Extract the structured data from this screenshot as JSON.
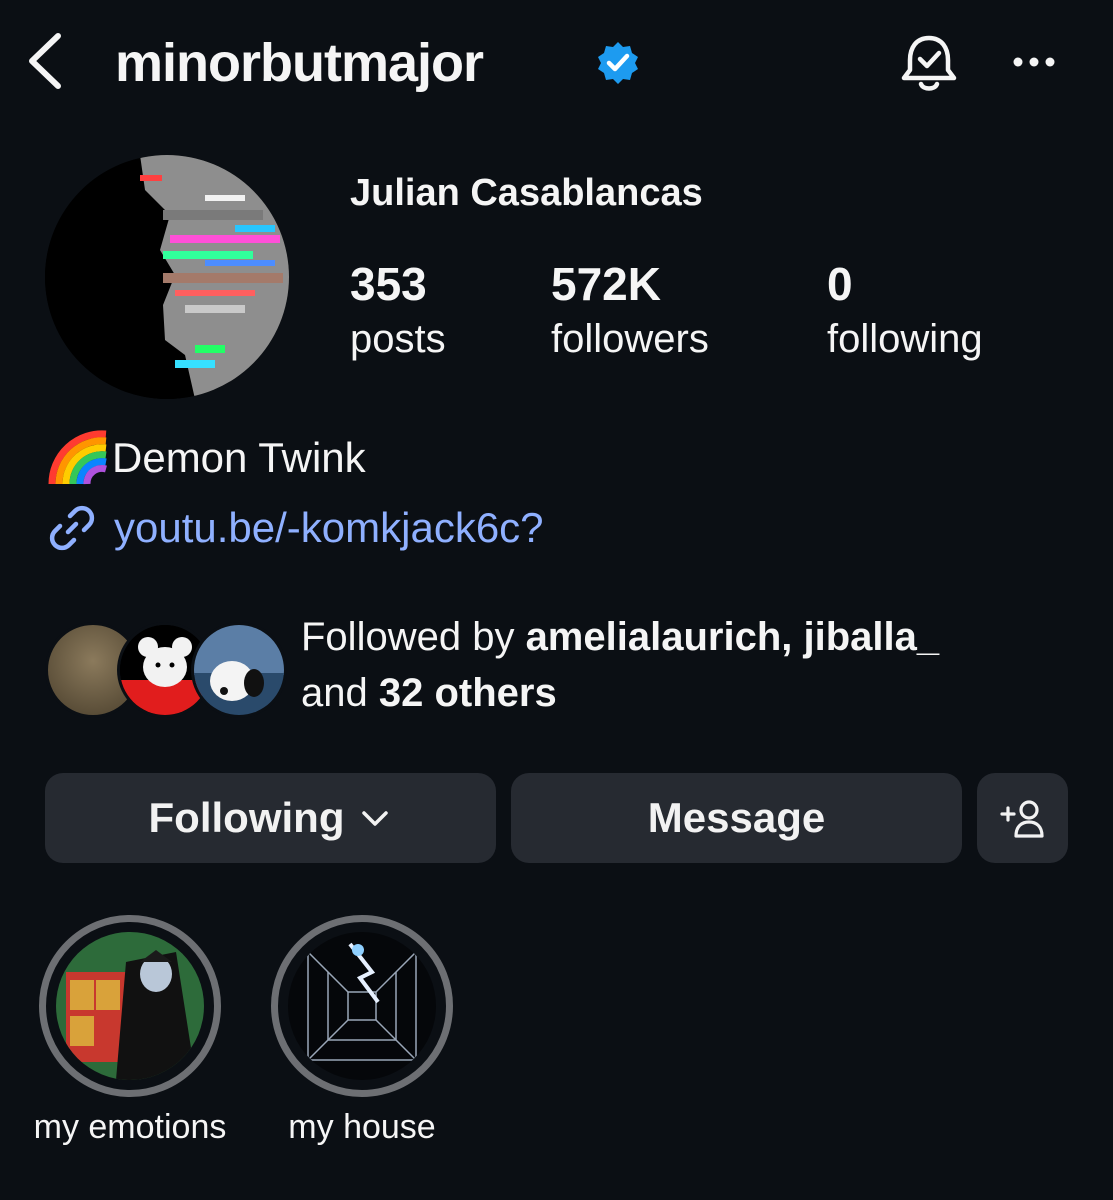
{
  "header": {
    "username": "minorbutmajor",
    "icons": {
      "back": "chevron-left-icon",
      "verified": "verified-badge-icon",
      "notifications": "bell-check-icon",
      "more": "more-horizontal-icon"
    }
  },
  "profile": {
    "full_name": "Julian Casablancas",
    "stats": [
      {
        "value": "353",
        "label": "posts"
      },
      {
        "value": "572K",
        "label": "followers"
      },
      {
        "value": "0",
        "label": "following"
      }
    ],
    "bio": "Demon Twink",
    "bio_emoji": "rainbow-emoji",
    "link": "youtu.be/-komkjack6c?"
  },
  "followed_by": {
    "prefix": "Followed by ",
    "names": "amelialaurich, jiballa_",
    "middle": "and ",
    "others": "32 others"
  },
  "buttons": {
    "following": "Following",
    "message": "Message"
  },
  "highlights": [
    {
      "label": "my emotions"
    },
    {
      "label": "my house"
    }
  ],
  "colors": {
    "background": "#0b0f14",
    "link": "#8fb0ff",
    "verified": "#1d9bf0",
    "button": "#262a31"
  }
}
